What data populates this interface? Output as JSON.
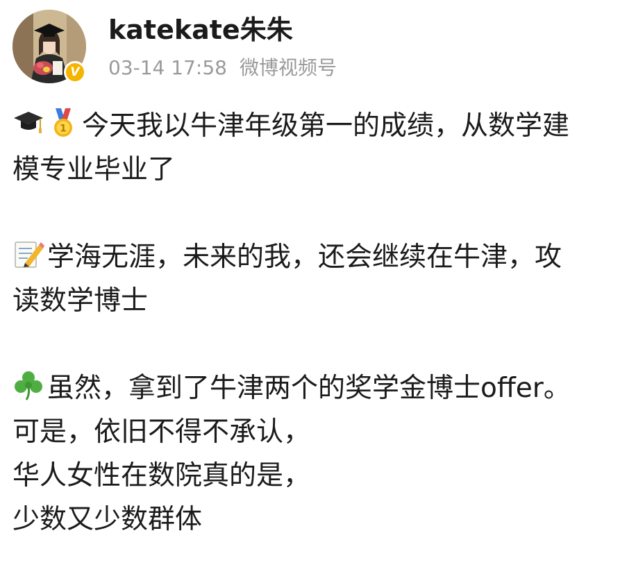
{
  "post": {
    "author": {
      "name": "katekate朱朱",
      "verified_label": "V"
    },
    "timestamp": "03-14 17:58",
    "source": "微博视频号",
    "paragraphs": [
      {
        "icons": [
          "graduation-cap-icon",
          "gold-medal-icon"
        ],
        "lines": [
          "今天我以牛津年级第一的成绩，从数学建",
          "模专业毕业了"
        ]
      },
      {
        "icons": [
          "memo-icon"
        ],
        "lines": [
          "学海无涯，未来的我，还会继续在牛津，攻",
          "读数学博士"
        ]
      },
      {
        "icons": [
          "shamrock-icon"
        ],
        "lines": [
          "虽然，拿到了牛津两个的奖学金博士offer。",
          "可是，依旧不得不承认，",
          "华人女性在数院真的是，",
          "少数又少数群体"
        ]
      }
    ]
  },
  "colors": {
    "text": "#1b1b1b",
    "meta": "#9a9a9a",
    "badge": "#f5b400"
  }
}
